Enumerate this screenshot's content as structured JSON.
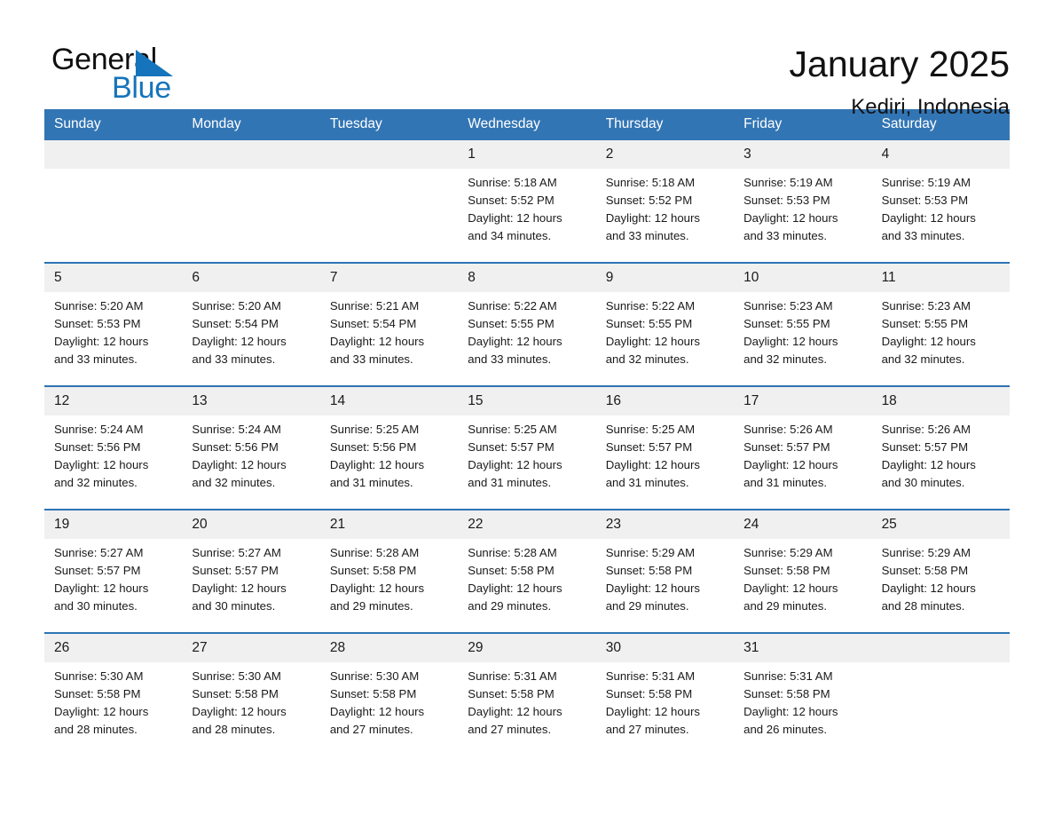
{
  "brand": {
    "name_part1": "General",
    "name_part2": "Blue",
    "triangle_color": "#1574bb"
  },
  "header": {
    "title": "January 2025",
    "location": "Kediri, Indonesia"
  },
  "colors": {
    "header_blue": "#3275b4",
    "row_rule_blue": "#2e74b5",
    "daynum_band": "#f0f0f0",
    "brand_blue": "#1574bb"
  },
  "weekdays": [
    "Sunday",
    "Monday",
    "Tuesday",
    "Wednesday",
    "Thursday",
    "Friday",
    "Saturday"
  ],
  "weeks": [
    [
      {
        "day": "",
        "sunrise": "",
        "sunset": "",
        "daylight1": "",
        "daylight2": ""
      },
      {
        "day": "",
        "sunrise": "",
        "sunset": "",
        "daylight1": "",
        "daylight2": ""
      },
      {
        "day": "",
        "sunrise": "",
        "sunset": "",
        "daylight1": "",
        "daylight2": ""
      },
      {
        "day": "1",
        "sunrise": "Sunrise: 5:18 AM",
        "sunset": "Sunset: 5:52 PM",
        "daylight1": "Daylight: 12 hours",
        "daylight2": "and 34 minutes."
      },
      {
        "day": "2",
        "sunrise": "Sunrise: 5:18 AM",
        "sunset": "Sunset: 5:52 PM",
        "daylight1": "Daylight: 12 hours",
        "daylight2": "and 33 minutes."
      },
      {
        "day": "3",
        "sunrise": "Sunrise: 5:19 AM",
        "sunset": "Sunset: 5:53 PM",
        "daylight1": "Daylight: 12 hours",
        "daylight2": "and 33 minutes."
      },
      {
        "day": "4",
        "sunrise": "Sunrise: 5:19 AM",
        "sunset": "Sunset: 5:53 PM",
        "daylight1": "Daylight: 12 hours",
        "daylight2": "and 33 minutes."
      }
    ],
    [
      {
        "day": "5",
        "sunrise": "Sunrise: 5:20 AM",
        "sunset": "Sunset: 5:53 PM",
        "daylight1": "Daylight: 12 hours",
        "daylight2": "and 33 minutes."
      },
      {
        "day": "6",
        "sunrise": "Sunrise: 5:20 AM",
        "sunset": "Sunset: 5:54 PM",
        "daylight1": "Daylight: 12 hours",
        "daylight2": "and 33 minutes."
      },
      {
        "day": "7",
        "sunrise": "Sunrise: 5:21 AM",
        "sunset": "Sunset: 5:54 PM",
        "daylight1": "Daylight: 12 hours",
        "daylight2": "and 33 minutes."
      },
      {
        "day": "8",
        "sunrise": "Sunrise: 5:22 AM",
        "sunset": "Sunset: 5:55 PM",
        "daylight1": "Daylight: 12 hours",
        "daylight2": "and 33 minutes."
      },
      {
        "day": "9",
        "sunrise": "Sunrise: 5:22 AM",
        "sunset": "Sunset: 5:55 PM",
        "daylight1": "Daylight: 12 hours",
        "daylight2": "and 32 minutes."
      },
      {
        "day": "10",
        "sunrise": "Sunrise: 5:23 AM",
        "sunset": "Sunset: 5:55 PM",
        "daylight1": "Daylight: 12 hours",
        "daylight2": "and 32 minutes."
      },
      {
        "day": "11",
        "sunrise": "Sunrise: 5:23 AM",
        "sunset": "Sunset: 5:55 PM",
        "daylight1": "Daylight: 12 hours",
        "daylight2": "and 32 minutes."
      }
    ],
    [
      {
        "day": "12",
        "sunrise": "Sunrise: 5:24 AM",
        "sunset": "Sunset: 5:56 PM",
        "daylight1": "Daylight: 12 hours",
        "daylight2": "and 32 minutes."
      },
      {
        "day": "13",
        "sunrise": "Sunrise: 5:24 AM",
        "sunset": "Sunset: 5:56 PM",
        "daylight1": "Daylight: 12 hours",
        "daylight2": "and 32 minutes."
      },
      {
        "day": "14",
        "sunrise": "Sunrise: 5:25 AM",
        "sunset": "Sunset: 5:56 PM",
        "daylight1": "Daylight: 12 hours",
        "daylight2": "and 31 minutes."
      },
      {
        "day": "15",
        "sunrise": "Sunrise: 5:25 AM",
        "sunset": "Sunset: 5:57 PM",
        "daylight1": "Daylight: 12 hours",
        "daylight2": "and 31 minutes."
      },
      {
        "day": "16",
        "sunrise": "Sunrise: 5:25 AM",
        "sunset": "Sunset: 5:57 PM",
        "daylight1": "Daylight: 12 hours",
        "daylight2": "and 31 minutes."
      },
      {
        "day": "17",
        "sunrise": "Sunrise: 5:26 AM",
        "sunset": "Sunset: 5:57 PM",
        "daylight1": "Daylight: 12 hours",
        "daylight2": "and 31 minutes."
      },
      {
        "day": "18",
        "sunrise": "Sunrise: 5:26 AM",
        "sunset": "Sunset: 5:57 PM",
        "daylight1": "Daylight: 12 hours",
        "daylight2": "and 30 minutes."
      }
    ],
    [
      {
        "day": "19",
        "sunrise": "Sunrise: 5:27 AM",
        "sunset": "Sunset: 5:57 PM",
        "daylight1": "Daylight: 12 hours",
        "daylight2": "and 30 minutes."
      },
      {
        "day": "20",
        "sunrise": "Sunrise: 5:27 AM",
        "sunset": "Sunset: 5:57 PM",
        "daylight1": "Daylight: 12 hours",
        "daylight2": "and 30 minutes."
      },
      {
        "day": "21",
        "sunrise": "Sunrise: 5:28 AM",
        "sunset": "Sunset: 5:58 PM",
        "daylight1": "Daylight: 12 hours",
        "daylight2": "and 29 minutes."
      },
      {
        "day": "22",
        "sunrise": "Sunrise: 5:28 AM",
        "sunset": "Sunset: 5:58 PM",
        "daylight1": "Daylight: 12 hours",
        "daylight2": "and 29 minutes."
      },
      {
        "day": "23",
        "sunrise": "Sunrise: 5:29 AM",
        "sunset": "Sunset: 5:58 PM",
        "daylight1": "Daylight: 12 hours",
        "daylight2": "and 29 minutes."
      },
      {
        "day": "24",
        "sunrise": "Sunrise: 5:29 AM",
        "sunset": "Sunset: 5:58 PM",
        "daylight1": "Daylight: 12 hours",
        "daylight2": "and 29 minutes."
      },
      {
        "day": "25",
        "sunrise": "Sunrise: 5:29 AM",
        "sunset": "Sunset: 5:58 PM",
        "daylight1": "Daylight: 12 hours",
        "daylight2": "and 28 minutes."
      }
    ],
    [
      {
        "day": "26",
        "sunrise": "Sunrise: 5:30 AM",
        "sunset": "Sunset: 5:58 PM",
        "daylight1": "Daylight: 12 hours",
        "daylight2": "and 28 minutes."
      },
      {
        "day": "27",
        "sunrise": "Sunrise: 5:30 AM",
        "sunset": "Sunset: 5:58 PM",
        "daylight1": "Daylight: 12 hours",
        "daylight2": "and 28 minutes."
      },
      {
        "day": "28",
        "sunrise": "Sunrise: 5:30 AM",
        "sunset": "Sunset: 5:58 PM",
        "daylight1": "Daylight: 12 hours",
        "daylight2": "and 27 minutes."
      },
      {
        "day": "29",
        "sunrise": "Sunrise: 5:31 AM",
        "sunset": "Sunset: 5:58 PM",
        "daylight1": "Daylight: 12 hours",
        "daylight2": "and 27 minutes."
      },
      {
        "day": "30",
        "sunrise": "Sunrise: 5:31 AM",
        "sunset": "Sunset: 5:58 PM",
        "daylight1": "Daylight: 12 hours",
        "daylight2": "and 27 minutes."
      },
      {
        "day": "31",
        "sunrise": "Sunrise: 5:31 AM",
        "sunset": "Sunset: 5:58 PM",
        "daylight1": "Daylight: 12 hours",
        "daylight2": "and 26 minutes."
      },
      {
        "day": "",
        "sunrise": "",
        "sunset": "",
        "daylight1": "",
        "daylight2": ""
      }
    ]
  ]
}
